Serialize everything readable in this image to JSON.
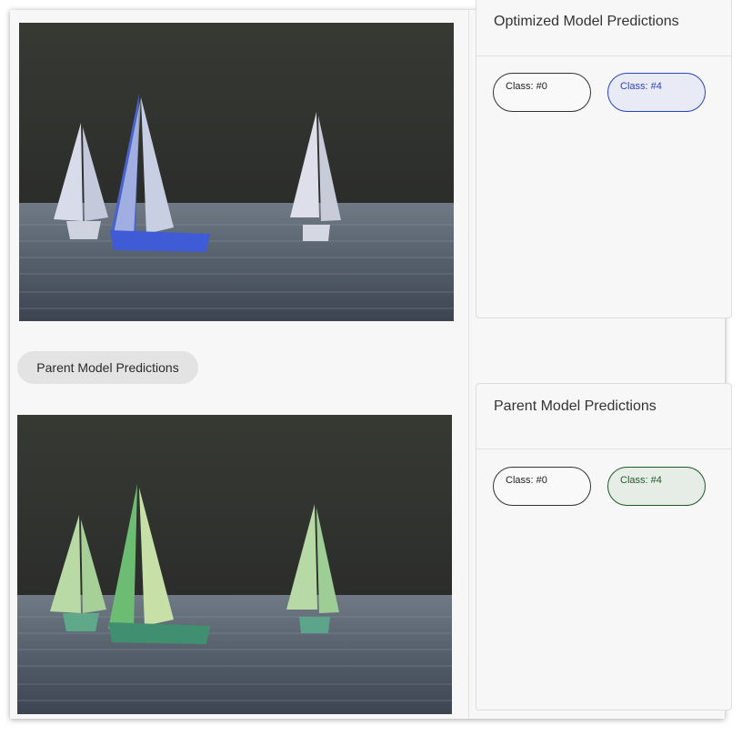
{
  "colors": {
    "optimized_accent": "#2b45b8",
    "optimized_fill": "#e8eaf6",
    "parent_accent": "#1f5a28",
    "parent_fill": "#e6ede7",
    "optimized_overlay": "#3f5bd6",
    "parent_overlay": "#4fae7a"
  },
  "images": {
    "optimized": {
      "overlay_class": "Class: #4"
    },
    "parent": {
      "overlay_class": "Class: #4"
    }
  },
  "chip": {
    "label": "Parent Model Predictions"
  },
  "cards": {
    "optimized": {
      "title": "Optimized Model Predictions",
      "predictions": [
        {
          "label": "Class: #0",
          "selected": false
        },
        {
          "label": "Class: #4",
          "selected": true
        }
      ]
    },
    "parent": {
      "title": "Parent Model Predictions",
      "predictions": [
        {
          "label": "Class: #0",
          "selected": false
        },
        {
          "label": "Class: #4",
          "selected": true
        }
      ]
    }
  }
}
